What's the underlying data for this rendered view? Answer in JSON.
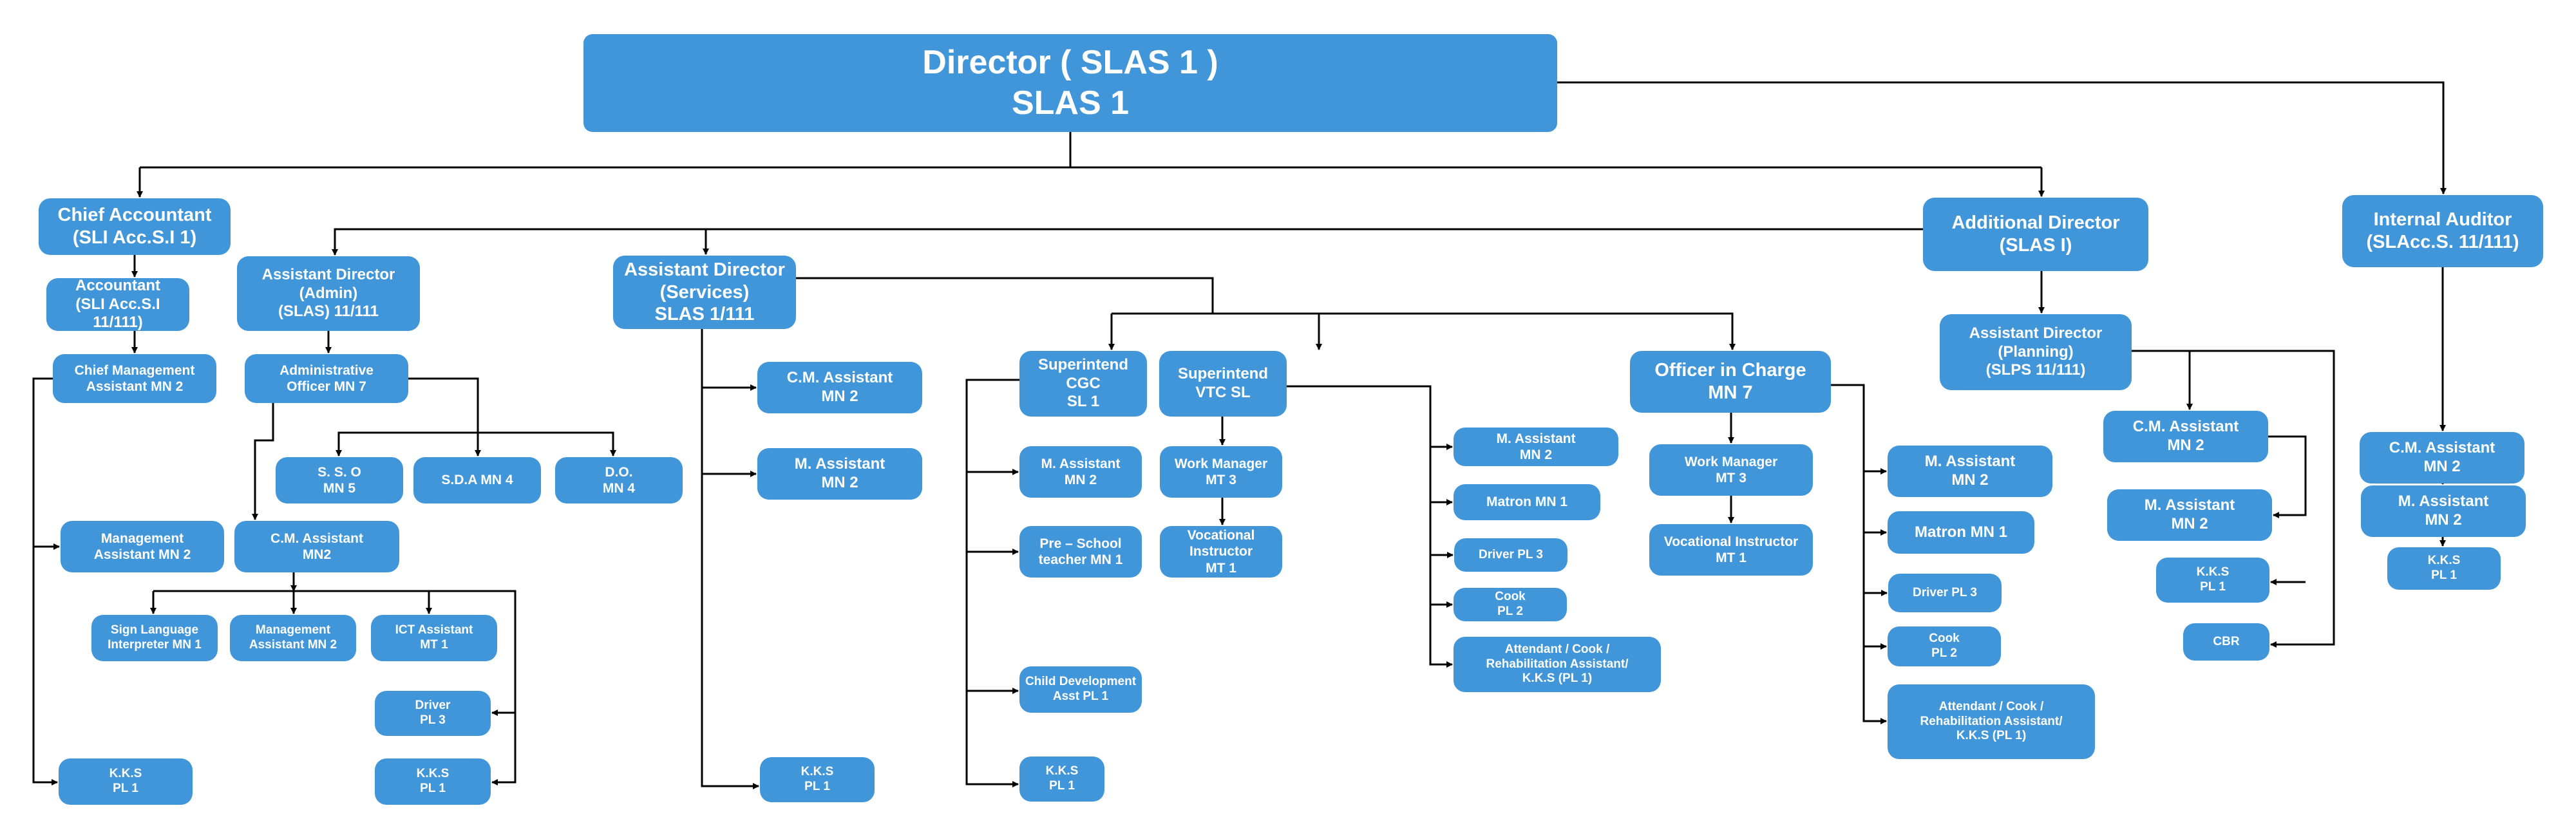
{
  "chart": {
    "box_color": "#4196da",
    "text_color": "#ffffff",
    "line_color": "#000000",
    "nodes": {
      "director": "Director ( SLAS 1 )\nSLAS 1",
      "chief_accountant": "Chief Accountant\n(SLI Acc.S.I 1)",
      "accountant": "Accountant\n(SLI Acc.S.I 11/111)",
      "chief_mgmt_assistant": "Chief Management\nAssistant MN 2",
      "mgmt_assistant_acc": "Management\nAssistant MN 2",
      "kks_acc": "K.K.S\nPL 1",
      "ad_admin": "Assistant Director\n(Admin)\n(SLAS) 11/111",
      "admin_officer": "Administrative\nOfficer MN 7",
      "sso": "S. S. O\nMN 5",
      "sda": "S.D.A MN 4",
      "do": "D.O.\nMN 4",
      "cm_assistant_admin": "C.M. Assistant\nMN2",
      "sign_language": "Sign Language\nInterpreter MN 1",
      "mgmt_assistant_admin": "Management\nAssistant MN 2",
      "ict_assistant": "ICT Assistant\nMT 1",
      "driver_admin": "Driver\nPL 3",
      "kks_admin": "K.K.S\nPL 1",
      "ad_services": "Assistant Director\n(Services)\nSLAS 1/111",
      "cm_assistant_services": "C.M. Assistant\nMN 2",
      "m_assistant_services": "M. Assistant\nMN 2",
      "kks_services": "K.K.S\nPL 1",
      "supt_cgc": "Superintend CGC\nSL 1",
      "m_assistant_cgc": "M. Assistant\nMN 2",
      "preschool_teacher": "Pre – School\nteacher MN 1",
      "child_dev_asst": "Child Development\nAsst PL 1",
      "kks_cgc": "K.K.S\nPL 1",
      "supt_vtc": "Superintend\nVTC SL",
      "work_manager_vtc": "Work Manager\nMT 3",
      "voc_instructor_vtc": "Vocational Instructor\nMT 1",
      "m_assistant_vtc": "M. Assistant\nMN 2",
      "matron_vtc": "Matron MN 1",
      "driver_vtc": "Driver PL 3",
      "cook_vtc": "Cook\nPL 2",
      "attendant_vtc": "Attendant / Cook /\nRehabilitation Assistant/\nK.K.S (PL 1)",
      "officer_in_charge": "Officer in Charge\nMN 7",
      "work_manager_oic": "Work Manager\nMT 3",
      "voc_instructor_oic": "Vocational Instructor\nMT 1",
      "m_assistant_oic": "M. Assistant\nMN 2",
      "matron_oic": "Matron MN 1",
      "driver_oic": "Driver PL 3",
      "cook_oic": "Cook\nPL 2",
      "attendant_oic": "Attendant / Cook /\nRehabilitation Assistant/\nK.K.S (PL 1)",
      "additional_director": "Additional Director\n(SLAS I)",
      "ad_planning": "Assistant Director\n(Planning)\n(SLPS 11/111)",
      "cm_assistant_planning": "C.M. Assistant\nMN 2",
      "m_assistant_planning": "M. Assistant\nMN 2",
      "kks_planning": "K.K.S\nPL 1",
      "cbr": "CBR",
      "internal_auditor": "Internal Auditor\n(SLAcc.S. 11/111)",
      "cm_assistant_audit": "C.M. Assistant\nMN 2",
      "m_assistant_audit": "M. Assistant\nMN 2",
      "kks_audit": "K.K.S\nPL 1"
    }
  }
}
